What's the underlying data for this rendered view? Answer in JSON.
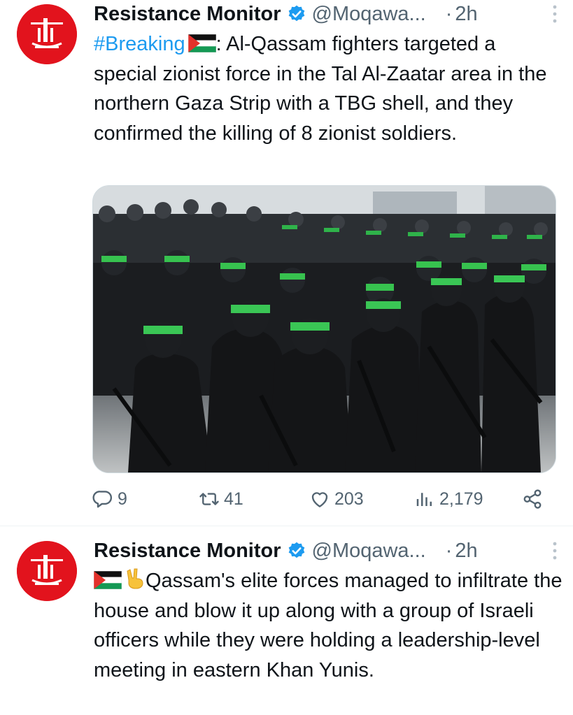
{
  "colors": {
    "link": "#1d9bf0",
    "text": "#0f1419",
    "muted": "#536471",
    "avatar_bg": "#e2131d",
    "verified": "#1d9bf0"
  },
  "tweets": [
    {
      "author": {
        "name": "Resistance Monitor",
        "handle": "@Moqawa...",
        "verified_icon": "verified-badge-icon",
        "avatar_icon": "red-emblem-avatar"
      },
      "dot": "·",
      "time": "2h",
      "hashtag": "#Breaking",
      "text_after_flag": ": Al-Qassam fighters targeted a special zionist force in the Tal Al-Zaatar area in the northern Gaza Strip with a TBG shell, and they confirmed the killing of 8 zionist soldiers.",
      "media_icon": "photo-armed-fighters-marching",
      "actions": {
        "reply": "9",
        "repost": "41",
        "like": "203",
        "views": "2,179"
      }
    },
    {
      "author": {
        "name": "Resistance Monitor",
        "handle": "@Moqawa...",
        "verified_icon": "verified-badge-icon",
        "avatar_icon": "red-emblem-avatar"
      },
      "dot": "·",
      "time": "2h",
      "text_after_emoji": "Qassam's elite forces managed to infiltrate the house and blow it up along with a group of Israeli officers while they were holding a leadership-level meeting in eastern Khan Yunis."
    }
  ]
}
